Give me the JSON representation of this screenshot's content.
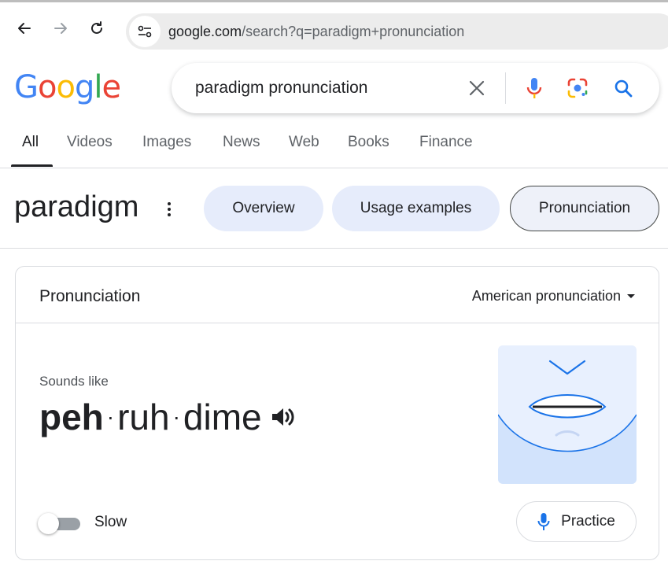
{
  "browser": {
    "url_host": "google.com",
    "url_path": "/search?q=paradigm+pronunciation"
  },
  "logo": {
    "letters": [
      "G",
      "o",
      "o",
      "g",
      "l",
      "e"
    ],
    "colors": [
      "#4285F4",
      "#EA4335",
      "#FBBC05",
      "#4285F4",
      "#34A853",
      "#EA4335"
    ]
  },
  "search": {
    "query": "paradigm pronunciation",
    "icons": [
      "close-icon",
      "microphone-icon",
      "google-lens-icon",
      "search-icon"
    ]
  },
  "tabs": [
    {
      "label": "All",
      "active": true
    },
    {
      "label": "Videos"
    },
    {
      "label": "Images"
    },
    {
      "label": "News"
    },
    {
      "label": "Web"
    },
    {
      "label": "Books"
    },
    {
      "label": "Finance"
    }
  ],
  "word": {
    "title": "paradigm",
    "chips": [
      {
        "label": "Overview"
      },
      {
        "label": "Usage examples"
      },
      {
        "label": "Pronunciation",
        "selected": true
      }
    ]
  },
  "pronunciation": {
    "title": "Pronunciation",
    "accent": "American pronunciation",
    "sounds_like_label": "Sounds like",
    "syllables": [
      "peh",
      "ruh",
      "dime"
    ],
    "stressed_syllable": "peh",
    "separator": "·",
    "slow_label": "Slow",
    "slow_enabled": false,
    "practice_label": "Practice"
  },
  "colors": {
    "accent_blue": "#1a73e8",
    "chip_bg": "#e6ecfb",
    "mouth_bg": "#e8f0fe",
    "mouth_chin": "#d2e3fc"
  }
}
